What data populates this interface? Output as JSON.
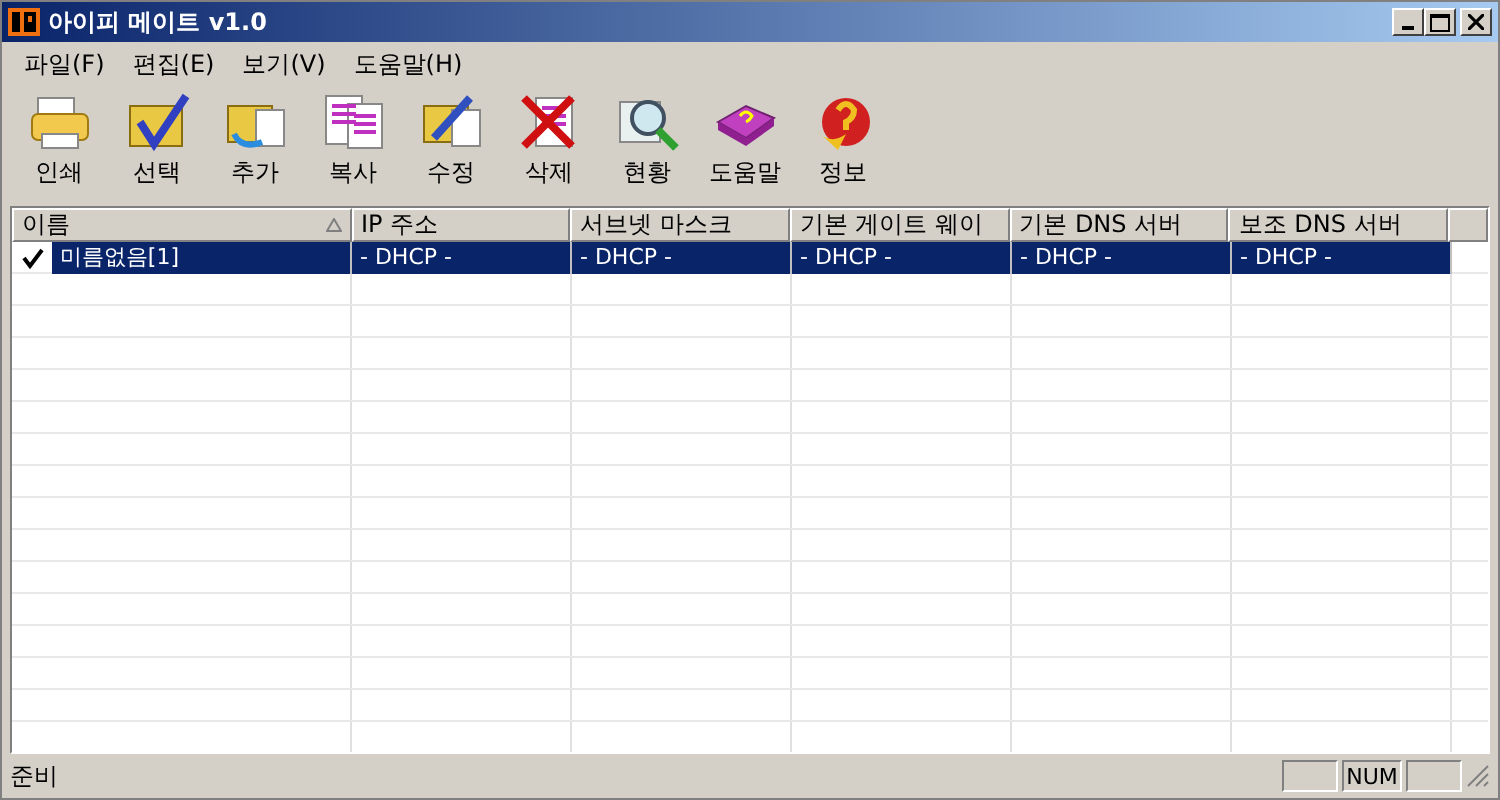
{
  "window": {
    "title": "아이피 메이트 v1.0"
  },
  "menu": [
    "파일(F)",
    "편집(E)",
    "보기(V)",
    "도움말(H)"
  ],
  "toolbar": [
    {
      "label": "인쇄",
      "kind": "print"
    },
    {
      "label": "선택",
      "kind": "select"
    },
    {
      "label": "추가",
      "kind": "add"
    },
    {
      "label": "복사",
      "kind": "copy"
    },
    {
      "label": "수정",
      "kind": "edit"
    },
    {
      "label": "삭제",
      "kind": "delete"
    },
    {
      "label": "현황",
      "kind": "status"
    },
    {
      "label": "도움말",
      "kind": "help"
    },
    {
      "label": "정보",
      "kind": "about"
    }
  ],
  "table": {
    "columns": [
      {
        "label": "이름",
        "sorted": true
      },
      {
        "label": "IP 주소",
        "sorted": false
      },
      {
        "label": "서브넷 마스크",
        "sorted": false
      },
      {
        "label": "기본 게이트 웨이",
        "sorted": false
      },
      {
        "label": "기본 DNS 서버",
        "sorted": false
      },
      {
        "label": "보조 DNS 서버",
        "sorted": false
      }
    ],
    "rows": [
      {
        "checked": true,
        "selected": true,
        "cells": [
          "미름없음[1]",
          "- DHCP -",
          "- DHCP -",
          "- DHCP -",
          "- DHCP -",
          "- DHCP -"
        ]
      }
    ]
  },
  "status_bar": {
    "text": "준비",
    "indicator": "NUM"
  }
}
